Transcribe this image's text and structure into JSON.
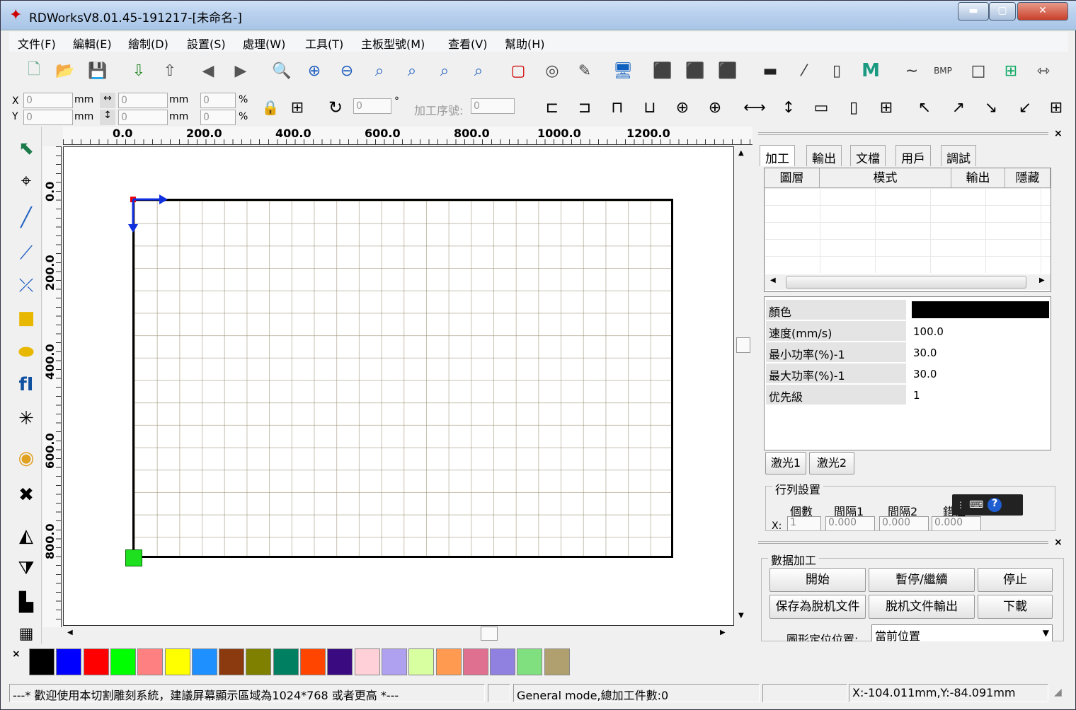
{
  "window": {
    "title": "RDWorksV8.01.45-191217-[未命名-]"
  },
  "menu": [
    "文件(F)",
    "編輯(E)",
    "繪制(D)",
    "設置(S)",
    "處理(W)",
    "工具(T)",
    "主板型號(M)",
    "查看(V)",
    "幫助(H)"
  ],
  "coords": {
    "x_label": "X",
    "y_label": "Y",
    "x_val": "0",
    "y_val": "0",
    "unit": "mm",
    "w_val": "0",
    "h_val": "0",
    "sx_val": "0",
    "sy_val": "0",
    "pct": "%",
    "rot_val": "0",
    "deg": "°",
    "order_label": "加工序號:",
    "order_val": "0"
  },
  "rulers": {
    "h": [
      "0.0",
      "200.0",
      "400.0",
      "600.0",
      "800.0",
      "1000.0",
      "1200.0"
    ],
    "v": [
      "0.0",
      "200.0",
      "400.0",
      "600.0",
      "800.0"
    ]
  },
  "tabs": [
    "加工",
    "輸出",
    "文檔",
    "用戶",
    "調試"
  ],
  "layer_grid": {
    "headers": [
      "圖層",
      "模式",
      "輸出",
      "隱藏"
    ]
  },
  "props": {
    "color_label": "顏色",
    "color_value": "#000000",
    "rows": [
      {
        "name": "速度(mm/s)",
        "value": "100.0"
      },
      {
        "name": "最小功率(%)-1",
        "value": "30.0"
      },
      {
        "name": "最大功率(%)-1",
        "value": "30.0"
      },
      {
        "name": "优先級",
        "value": "1"
      }
    ]
  },
  "laser_tabs": [
    "激光1",
    "激光2"
  ],
  "array": {
    "title": "行列設置",
    "cols": [
      "個數",
      "間隔1",
      "間隔2",
      "錯位"
    ],
    "x_label": "X:",
    "count": "1",
    "gap1": "0.000",
    "gap2": "0.000",
    "offset": "0.000"
  },
  "process": {
    "title": "數据加工",
    "start": "開始",
    "pause": "暫停/繼續",
    "stop": "停止",
    "save_offline": "保存為脫机文件",
    "offline_out": "脫机文件輸出",
    "download": "下載",
    "pos_label": "圖形定位位置:",
    "pos_value": "當前位置"
  },
  "palette": [
    "#000000",
    "#0000ff",
    "#ff0000",
    "#00ff00",
    "#ff8080",
    "#ffff00",
    "#1e90ff",
    "#8b3a0f",
    "#808000",
    "#008060",
    "#ff4500",
    "#3a0a80",
    "#ffd0d8",
    "#b0a0f0",
    "#d8ffa0",
    "#ff9a50",
    "#e07090",
    "#9080e0",
    "#80e080",
    "#b0a070"
  ],
  "status": {
    "welcome": "---* 歡迎使用本切割雕刻系統，建議屏幕顯示區域為1024*768 或者更高 *---",
    "mode": "General mode,總加工件數:0",
    "pos": "X:-104.011mm,Y:-84.091mm"
  },
  "toolbar2": {
    "bmp_label": "BMP",
    "m_label": "M"
  }
}
